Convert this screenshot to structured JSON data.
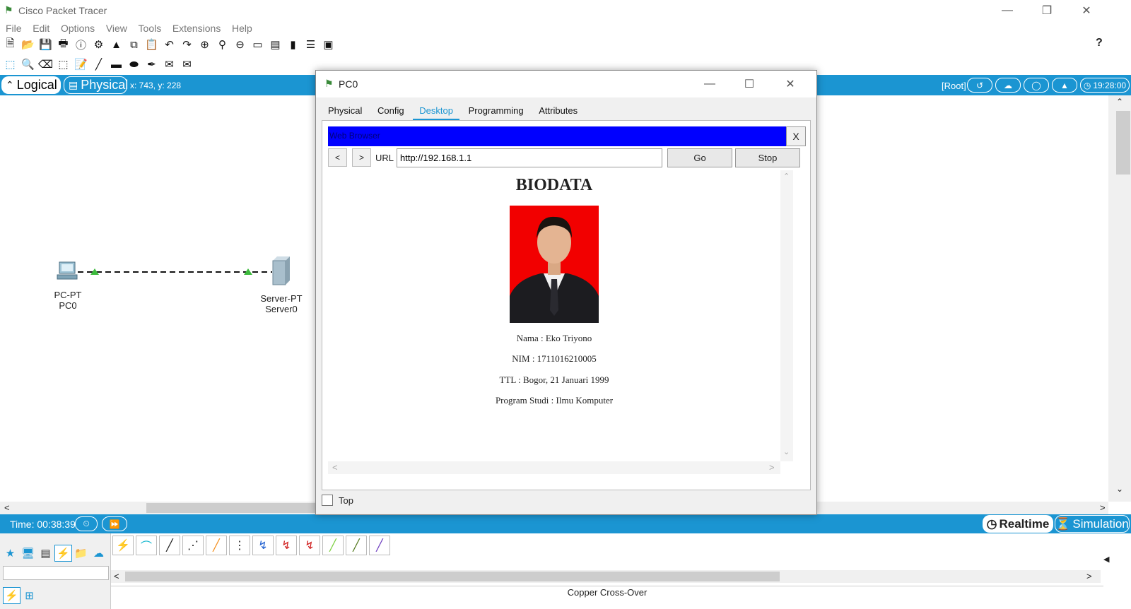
{
  "window": {
    "title": "Cisco Packet Tracer"
  },
  "menu": [
    "File",
    "Edit",
    "Options",
    "View",
    "Tools",
    "Extensions",
    "Help"
  ],
  "help_label": "?",
  "modes": {
    "logical": "Logical",
    "physical": "Physical",
    "coords": "x: 743, y: 228"
  },
  "root_label": "[Root]",
  "clock": "19:28:00",
  "devices": [
    {
      "type": "PC-PT",
      "name": "PC0"
    },
    {
      "type": "Server-PT",
      "name": "Server0"
    }
  ],
  "time_label": "Time: 00:38:39",
  "realtime": "Realtime",
  "simulation": "Simulation",
  "status": "Copper Cross-Over",
  "dialog": {
    "title": "PC0",
    "tabs": [
      "Physical",
      "Config",
      "Desktop",
      "Programming",
      "Attributes"
    ],
    "active_tab": "Desktop",
    "browser": {
      "title": "Web Browser",
      "close": "X",
      "back": "<",
      "forward": ">",
      "url_label": "URL",
      "url": "http://192.168.1.1",
      "go": "Go",
      "stop": "Stop"
    },
    "page": {
      "heading": "BIODATA",
      "lines": [
        "Nama : Eko Triyono",
        "NIM : 1711016210005",
        "TTL : Bogor, 21 Januari 1999",
        "Program Studi : Ilmu Komputer"
      ]
    },
    "top_label": "Top"
  },
  "colors": {
    "accent": "#1b95d2",
    "browser_bar": "#0000ff",
    "photo_bg": "#f20000"
  }
}
